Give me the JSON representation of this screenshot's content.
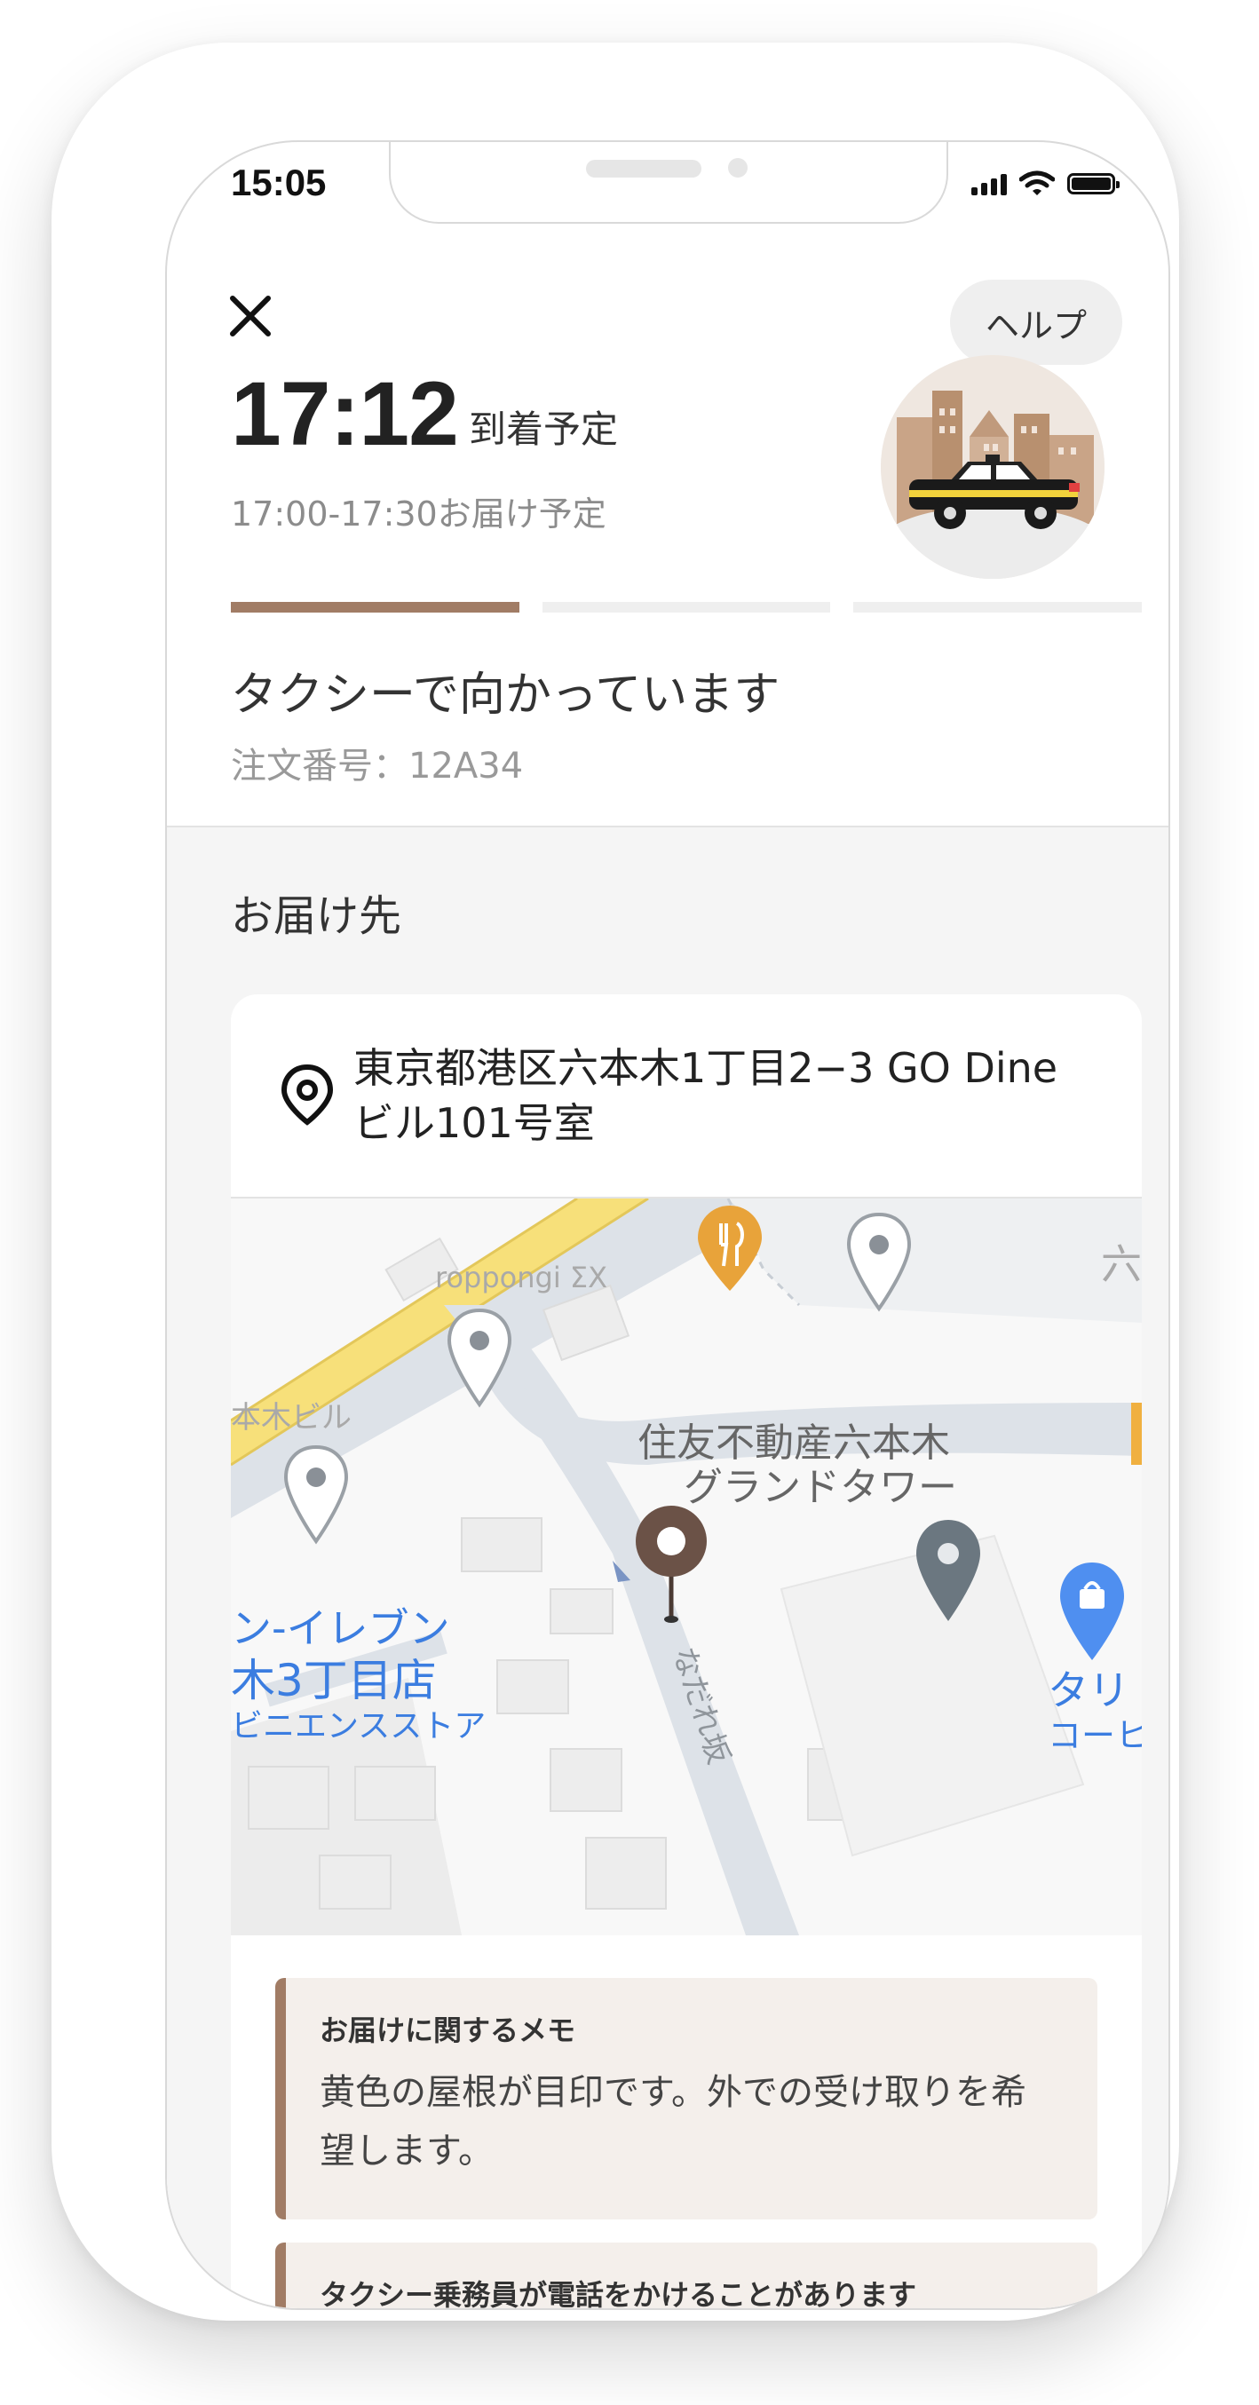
{
  "status_bar": {
    "time": "15:05"
  },
  "header": {
    "help_label": "ヘルプ"
  },
  "eta": {
    "time": "17:12",
    "label": "到着予定",
    "window": "17:00-17:30お届け予定"
  },
  "progress": {
    "steps_total": 3,
    "steps_completed": 1
  },
  "status": {
    "message": "タクシーで向かっています",
    "order_number": "注文番号：12A34"
  },
  "delivery": {
    "section_title": "お届け先",
    "address": "東京都港区六本木1丁目2−3 GO Dineビル101号室"
  },
  "map_labels": {
    "roppongi": "roppongi ΣX",
    "building_left": "本木ビル",
    "tower_line1": "住友不動産六本木",
    "tower_line2": "グランドタワー",
    "store_line1": "ン-イレブン",
    "store_line2": "木3丁目店",
    "store_line3": "ビニエンスストア",
    "street": "なだれ坂",
    "right_label1": "タリ",
    "right_label2": "コーヒ",
    "corner_label": "六"
  },
  "memos": [
    {
      "title": "お届けに関するメモ",
      "text": "黄色の屋根が目印です。外での受け取りを希望します。"
    },
    {
      "title": "タクシー乗務員が電話をかけることがあります"
    }
  ],
  "colors": {
    "accent": "#a17c65",
    "marker": "#6b5247",
    "road_yellow": "#f7e07a",
    "map_blue_label": "#3b7de0",
    "pin_grey": "#8a9097"
  }
}
